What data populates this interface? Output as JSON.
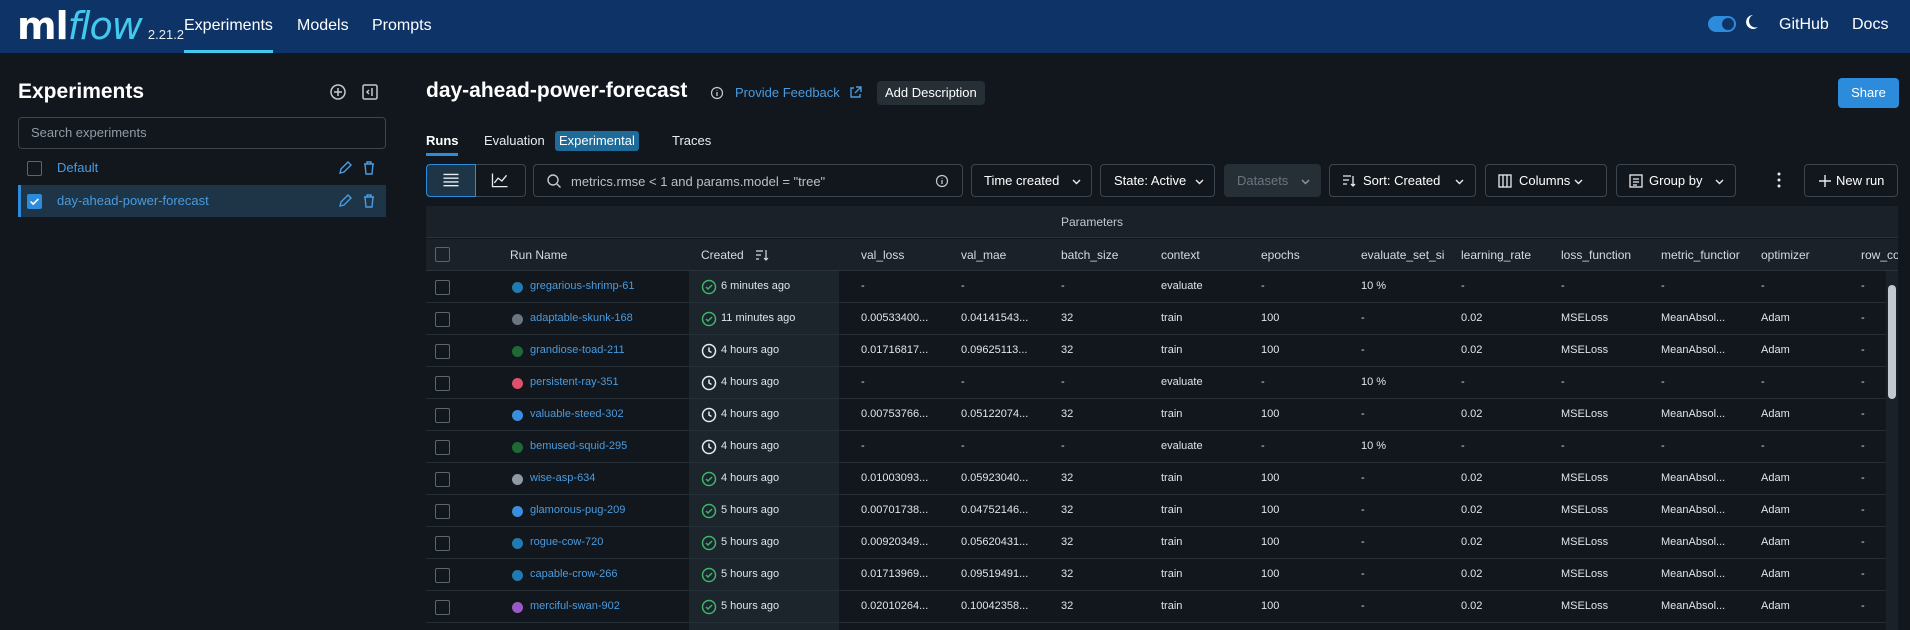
{
  "app": {
    "logo_ml": "ml",
    "logo_flow": "flow",
    "version": "2.21.2"
  },
  "nav": {
    "tabs": [
      "Experiments",
      "Models",
      "Prompts"
    ],
    "github": "GitHub",
    "docs": "Docs"
  },
  "sidebar": {
    "title": "Experiments",
    "search_placeholder": "Search experiments",
    "experiments": [
      {
        "label": "Default",
        "checked": false
      },
      {
        "label": "day-ahead-power-forecast",
        "checked": true
      }
    ]
  },
  "header": {
    "title": "day-ahead-power-forecast",
    "feedback": "Provide Feedback",
    "add_description": "Add Description",
    "share": "Share"
  },
  "subtabs": {
    "runs": "Runs",
    "evaluation": "Evaluation",
    "experimental_badge": "Experimental",
    "traces": "Traces"
  },
  "toolbar": {
    "search_value": "metrics.rmse < 1 and params.model = \"tree\"",
    "time_created": "Time created",
    "state": "State: Active",
    "datasets": "Datasets",
    "sort": "Sort: Created",
    "columns": "Columns",
    "group_by": "Group by",
    "new_run": "New run"
  },
  "table": {
    "group_header": "Parameters",
    "columns": [
      "Run Name",
      "Created",
      "val_loss",
      "val_mae",
      "batch_size",
      "context",
      "epochs",
      "evaluate_set_si",
      "learning_rate",
      "loss_function",
      "metric_functior",
      "optimizer",
      "row_co"
    ],
    "rows": [
      {
        "name": "gregarious-shrimp-61",
        "dot": "#1f7bb0",
        "status": "finished",
        "created": "6 minutes ago",
        "val_loss": "-",
        "val_mae": "-",
        "batch_size": "-",
        "context": "evaluate",
        "epochs": "-",
        "evaluate_set_size": "10 %",
        "learning_rate": "-",
        "loss_function": "-",
        "metric_function": "-",
        "optimizer": "-",
        "row": "-"
      },
      {
        "name": "adaptable-skunk-168",
        "dot": "#6b7580",
        "status": "finished",
        "created": "11 minutes ago",
        "val_loss": "0.00533400...",
        "val_mae": "0.04141543...",
        "batch_size": "32",
        "context": "train",
        "epochs": "100",
        "evaluate_set_size": "-",
        "learning_rate": "0.02",
        "loss_function": "MSELoss",
        "metric_function": "MeanAbsol...",
        "optimizer": "Adam",
        "row": "-"
      },
      {
        "name": "grandiose-toad-211",
        "dot": "#1d6b34",
        "status": "running",
        "created": "4 hours ago",
        "val_loss": "0.01716817...",
        "val_mae": "0.09625113...",
        "batch_size": "32",
        "context": "train",
        "epochs": "100",
        "evaluate_set_size": "-",
        "learning_rate": "0.02",
        "loss_function": "MSELoss",
        "metric_function": "MeanAbsol...",
        "optimizer": "Adam",
        "row": "-"
      },
      {
        "name": "persistent-ray-351",
        "dot": "#e0506a",
        "status": "running",
        "created": "4 hours ago",
        "val_loss": "-",
        "val_mae": "-",
        "batch_size": "-",
        "context": "evaluate",
        "epochs": "-",
        "evaluate_set_size": "10 %",
        "learning_rate": "-",
        "loss_function": "-",
        "metric_function": "-",
        "optimizer": "-",
        "row": "-"
      },
      {
        "name": "valuable-steed-302",
        "dot": "#3a8ee0",
        "status": "running",
        "created": "4 hours ago",
        "val_loss": "0.00753766...",
        "val_mae": "0.05122074...",
        "batch_size": "32",
        "context": "train",
        "epochs": "100",
        "evaluate_set_size": "-",
        "learning_rate": "0.02",
        "loss_function": "MSELoss",
        "metric_function": "MeanAbsol...",
        "optimizer": "Adam",
        "row": "-"
      },
      {
        "name": "bemused-squid-295",
        "dot": "#1d6b34",
        "status": "running",
        "created": "4 hours ago",
        "val_loss": "-",
        "val_mae": "-",
        "batch_size": "-",
        "context": "evaluate",
        "epochs": "-",
        "evaluate_set_size": "10 %",
        "learning_rate": "-",
        "loss_function": "-",
        "metric_function": "-",
        "optimizer": "-",
        "row": "-"
      },
      {
        "name": "wise-asp-634",
        "dot": "#8e99a4",
        "status": "finished",
        "created": "4 hours ago",
        "val_loss": "0.01003093...",
        "val_mae": "0.05923040...",
        "batch_size": "32",
        "context": "train",
        "epochs": "100",
        "evaluate_set_size": "-",
        "learning_rate": "0.02",
        "loss_function": "MSELoss",
        "metric_function": "MeanAbsol...",
        "optimizer": "Adam",
        "row": "-"
      },
      {
        "name": "glamorous-pug-209",
        "dot": "#3a8ee0",
        "status": "finished",
        "created": "5 hours ago",
        "val_loss": "0.00701738...",
        "val_mae": "0.04752146...",
        "batch_size": "32",
        "context": "train",
        "epochs": "100",
        "evaluate_set_size": "-",
        "learning_rate": "0.02",
        "loss_function": "MSELoss",
        "metric_function": "MeanAbsol...",
        "optimizer": "Adam",
        "row": "-"
      },
      {
        "name": "rogue-cow-720",
        "dot": "#1f7bb0",
        "status": "finished",
        "created": "5 hours ago",
        "val_loss": "0.00920349...",
        "val_mae": "0.05620431...",
        "batch_size": "32",
        "context": "train",
        "epochs": "100",
        "evaluate_set_size": "-",
        "learning_rate": "0.02",
        "loss_function": "MSELoss",
        "metric_function": "MeanAbsol...",
        "optimizer": "Adam",
        "row": "-"
      },
      {
        "name": "capable-crow-266",
        "dot": "#1f7bb0",
        "status": "finished",
        "created": "5 hours ago",
        "val_loss": "0.01713969...",
        "val_mae": "0.09519491...",
        "batch_size": "32",
        "context": "train",
        "epochs": "100",
        "evaluate_set_size": "-",
        "learning_rate": "0.02",
        "loss_function": "MSELoss",
        "metric_function": "MeanAbsol...",
        "optimizer": "Adam",
        "row": "-"
      },
      {
        "name": "merciful-swan-902",
        "dot": "#9b59c6",
        "status": "finished",
        "created": "5 hours ago",
        "val_loss": "0.02010264...",
        "val_mae": "0.10042358...",
        "batch_size": "32",
        "context": "train",
        "epochs": "100",
        "evaluate_set_size": "-",
        "learning_rate": "0.02",
        "loss_function": "MSELoss",
        "metric_function": "MeanAbsol...",
        "optimizer": "Adam",
        "row": "-"
      }
    ]
  }
}
